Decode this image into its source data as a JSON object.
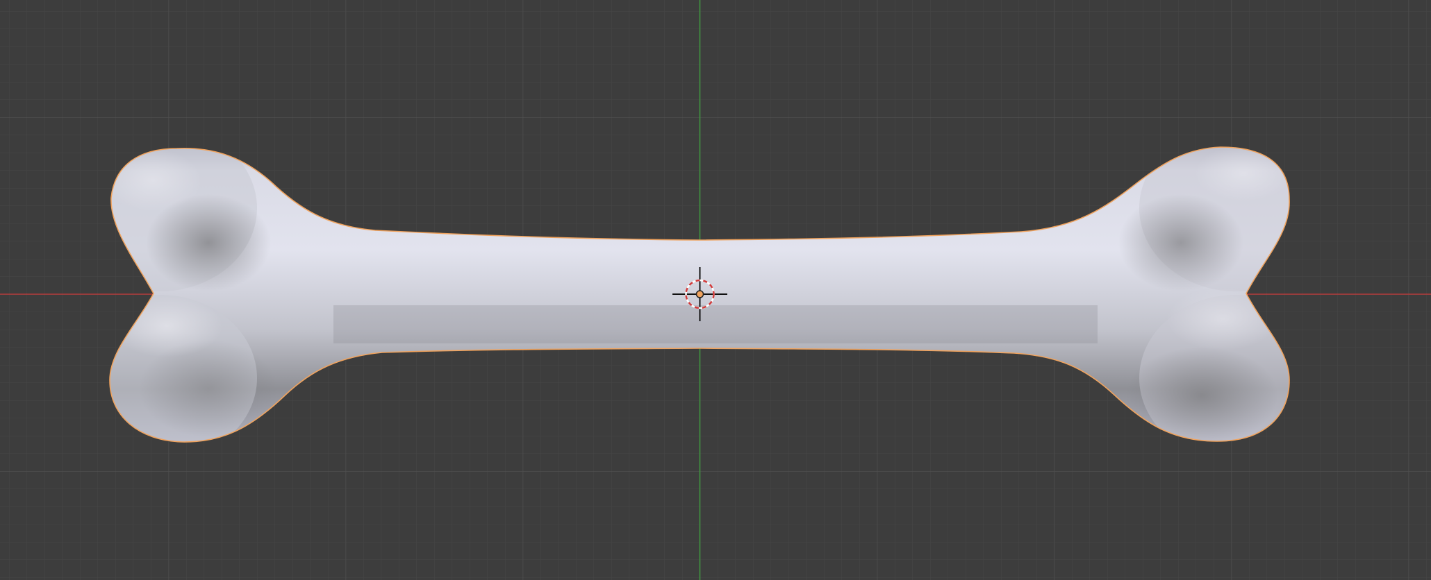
{
  "viewport": {
    "view": "3D Viewport",
    "background_color": "#3d3d3d",
    "grid_minor_color": "#464646",
    "grid_major_color": "#4f4f4f",
    "x_axis_color": "#b23a3a",
    "y_axis_color": "#3f9a3f"
  },
  "object": {
    "type": "mesh",
    "shape": "bone",
    "selected": true,
    "outline_color": "#f0a35e",
    "base_color": "#d6d6e3"
  },
  "cursor_3d": {
    "icon": "3d-cursor-icon",
    "ring_colors": [
      "#d23a3a",
      "#ffffff"
    ]
  },
  "origin": {
    "icon": "object-origin-dot",
    "color": "#f0a35e"
  }
}
